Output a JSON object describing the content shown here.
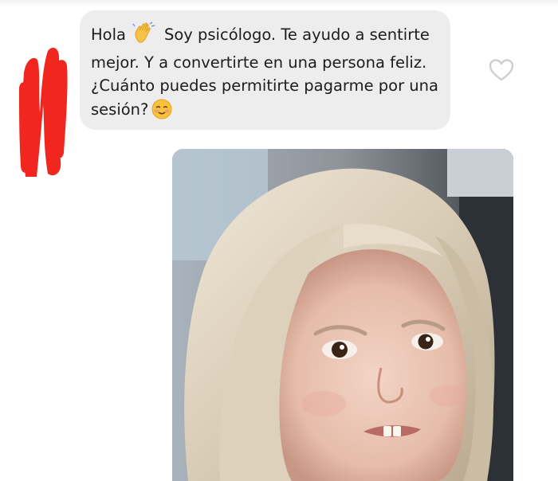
{
  "message": {
    "lines": [
      [
        "Hola",
        "Soy psicólogo. Te ayudo a sentirte"
      ],
      "mejor. Y a convertirte en una persona feliz.",
      "¿Cuánto puedes permitirte pagarme por una",
      "sesión?"
    ],
    "emojis": [
      "waving-hand",
      "smiling-face"
    ]
  },
  "colors": {
    "bubble": "#ededed",
    "text": "#1c1c1c",
    "redaction": "#f0261f",
    "heart_outline": "#cfcfcf"
  },
  "icons": {
    "like": "heart-outline-icon",
    "wave": "waving-hand-icon",
    "smile": "smiling-face-icon"
  }
}
